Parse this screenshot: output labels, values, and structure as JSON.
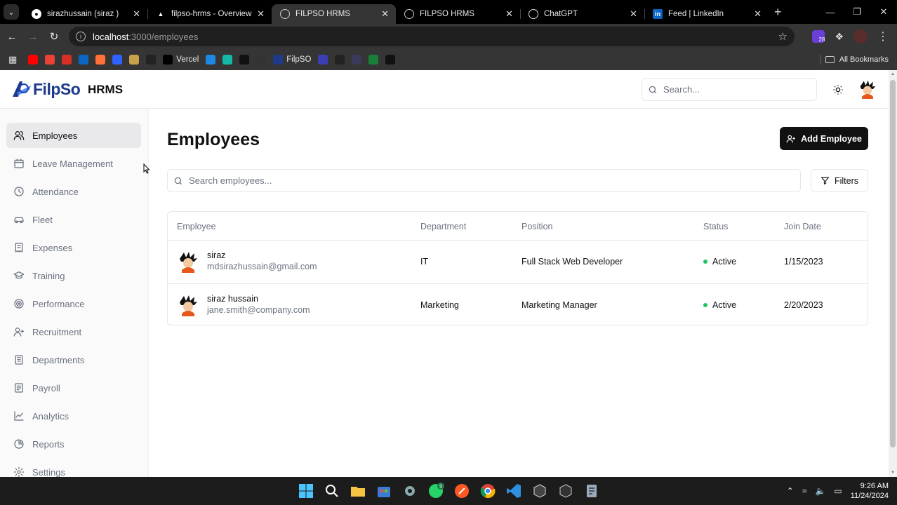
{
  "browser": {
    "tabs": [
      {
        "title": "sirazhussain (siraz )",
        "active": false
      },
      {
        "title": "filpso-hrms - Overview – V",
        "active": false
      },
      {
        "title": "FILPSO HRMS",
        "active": true
      },
      {
        "title": "FILPSO HRMS",
        "active": false
      },
      {
        "title": "ChatGPT",
        "active": false
      },
      {
        "title": "Feed | LinkedIn",
        "active": false
      }
    ],
    "url_host": "localhost",
    "url_path": ":3000/employees",
    "extension_badge": "28",
    "bookmarks": [
      {
        "label": "",
        "icon": "youtube-icon",
        "color": "#ff0000"
      },
      {
        "label": "",
        "icon": "gmail-icon",
        "color": "#ea4335"
      },
      {
        "label": "",
        "icon": "m-app-icon",
        "color": "#d93025"
      },
      {
        "label": "",
        "icon": "linkedin-icon",
        "color": "#0a66c2"
      },
      {
        "label": "",
        "icon": "firefox-icon",
        "color": "#ff7139"
      },
      {
        "label": "",
        "icon": "search-app-icon",
        "color": "#2f62ff"
      },
      {
        "label": "",
        "icon": "bird-icon",
        "color": "#c8a24a"
      },
      {
        "label": "",
        "icon": "notion-icon",
        "color": "#222222"
      },
      {
        "label": "Vercel",
        "icon": "vercel-icon",
        "color": "#000000"
      },
      {
        "label": "",
        "icon": "ist-icon",
        "color": "#1e88e5"
      },
      {
        "label": "",
        "icon": "diamond-icon",
        "color": "#14b8a6"
      },
      {
        "label": "",
        "icon": "github-icon",
        "color": "#111111"
      },
      {
        "label": "",
        "icon": "openai-icon",
        "color": "#333333"
      },
      {
        "label": "FilpSO",
        "icon": "filpso-icon",
        "color": "#1e3a8a"
      },
      {
        "label": "",
        "icon": "globe-icon",
        "color": "#3b3fb6"
      },
      {
        "label": "",
        "icon": "puzzle-icon",
        "color": "#222222"
      },
      {
        "label": "",
        "icon": "grid-app-icon",
        "color": "#3a3a5a"
      },
      {
        "label": "",
        "icon": "w-app-icon",
        "color": "#1a7f37"
      },
      {
        "label": "",
        "icon": "b-app-icon",
        "color": "#111111"
      }
    ],
    "all_bookmarks_label": "All Bookmarks"
  },
  "app": {
    "logo_text": "FilpSo",
    "app_name": "HRMS",
    "search_placeholder": "Search...",
    "sidebar": [
      {
        "label": "Employees",
        "icon": "users-icon",
        "active": true
      },
      {
        "label": "Leave Management",
        "icon": "calendar-icon",
        "active": false
      },
      {
        "label": "Attendance",
        "icon": "clock-icon",
        "active": false
      },
      {
        "label": "Fleet",
        "icon": "car-icon",
        "active": false
      },
      {
        "label": "Expenses",
        "icon": "receipt-icon",
        "active": false
      },
      {
        "label": "Training",
        "icon": "graduation-cap-icon",
        "active": false
      },
      {
        "label": "Performance",
        "icon": "target-icon",
        "active": false
      },
      {
        "label": "Recruitment",
        "icon": "user-plus-icon",
        "active": false
      },
      {
        "label": "Departments",
        "icon": "building-icon",
        "active": false
      },
      {
        "label": "Payroll",
        "icon": "wallet-icon",
        "active": false
      },
      {
        "label": "Analytics",
        "icon": "line-chart-icon",
        "active": false
      },
      {
        "label": "Reports",
        "icon": "pie-chart-icon",
        "active": false
      },
      {
        "label": "Settings",
        "icon": "gear-icon",
        "active": false
      }
    ],
    "page_title": "Employees",
    "add_button_label": "Add Employee",
    "employee_search_placeholder": "Search employees...",
    "filters_label": "Filters",
    "table": {
      "headers": [
        "Employee",
        "Department",
        "Position",
        "Status",
        "Join Date"
      ],
      "rows": [
        {
          "name": "siraz",
          "email": "mdsirazhussain@gmail.com",
          "department": "IT",
          "position": "Full Stack Web Developer",
          "status": "Active",
          "join_date": "1/15/2023"
        },
        {
          "name": "siraz hussain",
          "email": "jane.smith@company.com",
          "department": "Marketing",
          "position": "Marketing Manager",
          "status": "Active",
          "join_date": "2/20/2023"
        }
      ]
    },
    "status_color": "#22c55e",
    "accent_color": "#111111"
  },
  "taskbar": {
    "time": "9:26 AM",
    "date": "11/24/2024",
    "whatsapp_badge": "9"
  }
}
